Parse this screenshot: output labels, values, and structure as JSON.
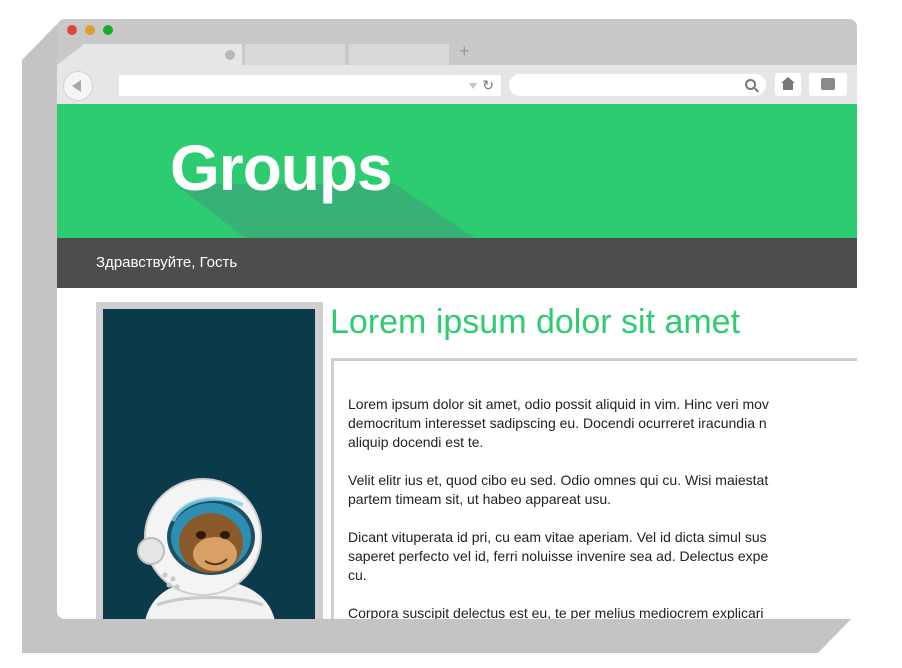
{
  "browser": {
    "tabs": [
      {
        "label": ""
      },
      {
        "label": ""
      },
      {
        "label": ""
      }
    ],
    "new_tab_label": "+",
    "address_value": "",
    "search_value": ""
  },
  "page": {
    "banner_title": "Groups",
    "greeting": "Здравствуйте, Гость",
    "heading": "Lorem ipsum dolor sit amet",
    "paragraphs": [
      "Lorem ipsum dolor sit amet, odio possit aliquid in vim. Hinc veri mov\ndemocritum interesset sadipscing eu. Docendi ocurreret iracundia n\naliquip docendi est te.",
      "Velit elitr ius et, quod cibo eu sed. Odio omnes qui cu. Wisi maiestat\npartem timeam sit, ut habeo appareat usu.",
      "Dicant vituperata id pri, cu eam vitae aperiam. Vel id dicta simul sus\nsaperet perfecto vel id, ferri noluisse invenire sea ad. Delectus expe\ncu.",
      "Corpora suscipit delectus est eu, te per melius mediocrem explicari"
    ]
  },
  "colors": {
    "accent_green": "#2ecc71",
    "navbar": "#4d4d4d",
    "sidebar_background": "#0b3b4a"
  },
  "icons": [
    "back-arrow-icon",
    "dropdown-icon",
    "reload-icon",
    "search-icon",
    "home-icon",
    "extension-icon",
    "tab-close-icon",
    "astronaut-monkey-mascot"
  ]
}
